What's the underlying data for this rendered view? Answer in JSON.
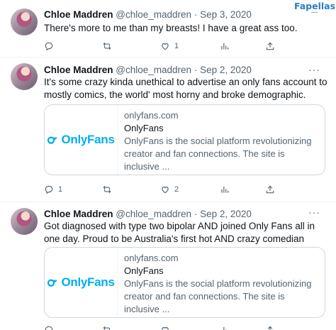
{
  "watermark": {
    "text": "Fapellas"
  },
  "tweets": [
    {
      "name": "Chloe Maddren",
      "handle": "@chloe_maddren",
      "dot": "·",
      "date": "Sep 3, 2020",
      "text": "There's more to me than my breasts! I have a great ass too.",
      "replies": "",
      "retweets": "",
      "likes": "1",
      "views": "",
      "card": null
    },
    {
      "name": "Chloe Maddren",
      "handle": "@chloe_maddren",
      "dot": "·",
      "date": "Sep 2, 2020",
      "text": "It's some crazy kinda unethical to advertise an only fans account to mostly comics, the world' most horny and broke demographic.",
      "replies": "1",
      "retweets": "",
      "likes": "2",
      "views": "",
      "card": {
        "logo": "OnlyFans",
        "domain": "onlyfans.com",
        "title": "OnlyFans",
        "description": "OnlyFans is the social platform revolutionizing creator and fan connections. The site is inclusive ..."
      }
    },
    {
      "name": "Chloe Maddren",
      "handle": "@chloe_maddren",
      "dot": "·",
      "date": "Sep 2, 2020",
      "text": "Got diagnosed with type two bipolar AND joined Only Fans all in one day. Proud to be Australia's first hot AND crazy comedian",
      "replies": "",
      "retweets": "",
      "likes": "",
      "views": "",
      "card": {
        "logo": "OnlyFans",
        "domain": "onlyfans.com",
        "title": "OnlyFans",
        "description": "OnlyFans is the social platform revolutionizing creator and fan connections. The site is inclusive ..."
      }
    }
  ],
  "icons": {
    "reply": "reply-icon",
    "retweet": "retweet-icon",
    "like": "like-icon",
    "views": "views-icon",
    "share": "share-icon",
    "more": "more-icon"
  },
  "colors": {
    "text": "#0f1419",
    "muted": "#536471",
    "border": "#cfd9de",
    "onlyfans_blue": "#00aff0",
    "watermark": "#2a7fc4"
  }
}
